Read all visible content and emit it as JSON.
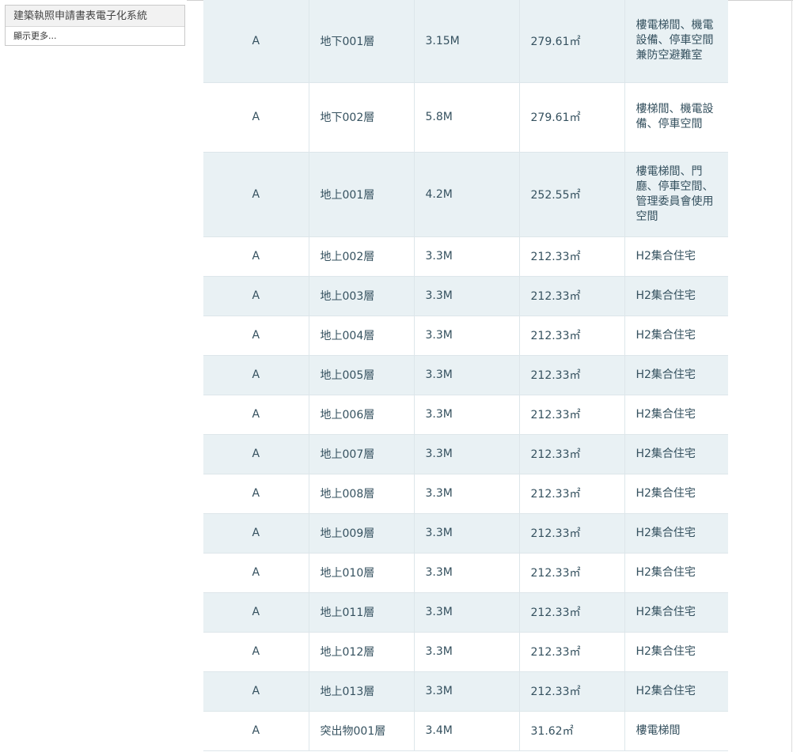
{
  "menu": {
    "item_label": "建築執照申請書表電子化系統",
    "show_more_label": "顯示更多..."
  },
  "floors": [
    {
      "building": "A",
      "floor": "地下001層",
      "height": "3.15M",
      "area": "279.61㎡",
      "use": "樓電梯間、機電設備、停車空間兼防空避難室"
    },
    {
      "building": "A",
      "floor": "地下002層",
      "height": "5.8M",
      "area": "279.61㎡",
      "use": "樓梯間、機電設備、停車空間"
    },
    {
      "building": "A",
      "floor": "地上001層",
      "height": "4.2M",
      "area": "252.55㎡",
      "use": "樓電梯間、門廳、停車空間、管理委員會使用空間"
    },
    {
      "building": "A",
      "floor": "地上002層",
      "height": "3.3M",
      "area": "212.33㎡",
      "use": "H2集合住宅"
    },
    {
      "building": "A",
      "floor": "地上003層",
      "height": "3.3M",
      "area": "212.33㎡",
      "use": "H2集合住宅"
    },
    {
      "building": "A",
      "floor": "地上004層",
      "height": "3.3M",
      "area": "212.33㎡",
      "use": "H2集合住宅"
    },
    {
      "building": "A",
      "floor": "地上005層",
      "height": "3.3M",
      "area": "212.33㎡",
      "use": "H2集合住宅"
    },
    {
      "building": "A",
      "floor": "地上006層",
      "height": "3.3M",
      "area": "212.33㎡",
      "use": "H2集合住宅"
    },
    {
      "building": "A",
      "floor": "地上007層",
      "height": "3.3M",
      "area": "212.33㎡",
      "use": "H2集合住宅"
    },
    {
      "building": "A",
      "floor": "地上008層",
      "height": "3.3M",
      "area": "212.33㎡",
      "use": "H2集合住宅"
    },
    {
      "building": "A",
      "floor": "地上009層",
      "height": "3.3M",
      "area": "212.33㎡",
      "use": "H2集合住宅"
    },
    {
      "building": "A",
      "floor": "地上010層",
      "height": "3.3M",
      "area": "212.33㎡",
      "use": "H2集合住宅"
    },
    {
      "building": "A",
      "floor": "地上011層",
      "height": "3.3M",
      "area": "212.33㎡",
      "use": "H2集合住宅"
    },
    {
      "building": "A",
      "floor": "地上012層",
      "height": "3.3M",
      "area": "212.33㎡",
      "use": "H2集合住宅"
    },
    {
      "building": "A",
      "floor": "地上013層",
      "height": "3.3M",
      "area": "212.33㎡",
      "use": "H2集合住宅"
    },
    {
      "building": "A",
      "floor": "突出物001層",
      "height": "3.4M",
      "area": "31.62㎡",
      "use": "樓電梯間"
    }
  ]
}
